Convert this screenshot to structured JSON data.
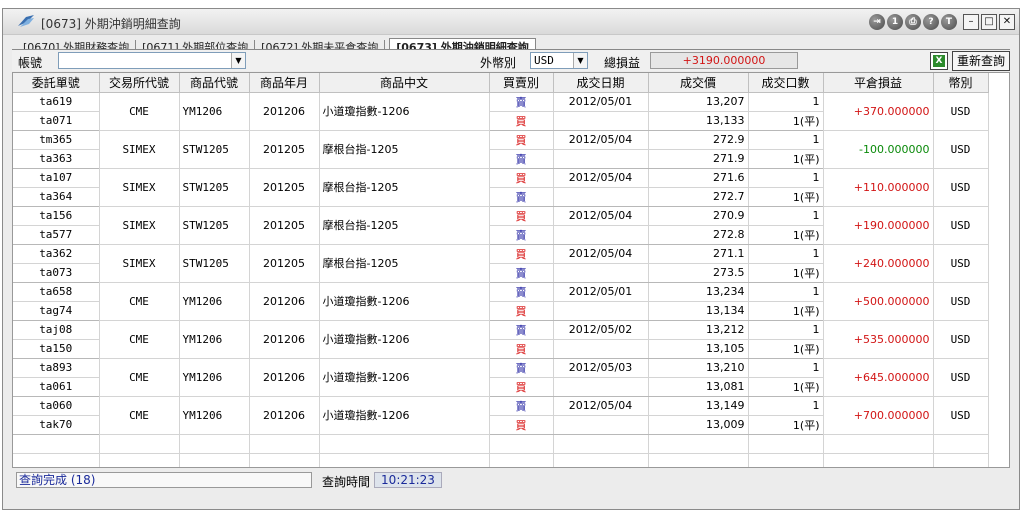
{
  "window": {
    "title": "[0673] 外期沖銷明細查詢",
    "toolbar_icons": [
      "switch-icon",
      "info-1-icon",
      "print-icon",
      "help-icon",
      "t-icon"
    ],
    "toolbar_icon_glyphs": [
      "⇥",
      "1",
      "⎙",
      "?",
      "T"
    ]
  },
  "tabs": [
    {
      "label": "[0670] 外期財務查詢",
      "active": false
    },
    {
      "label": "[0671] 外期部位查詢",
      "active": false
    },
    {
      "label": "[0672] 外期未平倉查詢",
      "active": false
    },
    {
      "label": "[0673] 外期沖銷明細查詢",
      "active": true
    }
  ],
  "toolbar": {
    "account_label": "帳號",
    "account_value": "",
    "currency_label": "外幣別",
    "currency_value": "USD",
    "total_pnl_label": "總損益",
    "total_pnl_value": "+3190.000000",
    "export_icon": "excel-icon",
    "refresh_label": "重新查詢"
  },
  "table": {
    "columns": [
      "委託單號",
      "交易所代號",
      "商品代號",
      "商品年月",
      "商品中文",
      "買賣別",
      "成交日期",
      "成交價",
      "成交口數",
      "平倉損益",
      "幣別"
    ],
    "groups": [
      {
        "exchange": "CME",
        "symbol": "YM1206",
        "ym": "201206",
        "name": "小道瓊指數-1206",
        "pnl": "+370.000000",
        "pnl_sign": "pos",
        "currency": "USD",
        "rows": [
          {
            "order": "ta619",
            "side": "賣",
            "side_type": "sell",
            "date": "2012/05/01",
            "price": "13,207",
            "qty": "1"
          },
          {
            "order": "ta071",
            "side": "買",
            "side_type": "buy",
            "date": "",
            "price": "13,133",
            "qty": "1(平)"
          }
        ]
      },
      {
        "exchange": "SIMEX",
        "symbol": "STW1205",
        "ym": "201205",
        "name": "摩根台指-1205",
        "pnl": "-100.000000",
        "pnl_sign": "neg",
        "currency": "USD",
        "rows": [
          {
            "order": "tm365",
            "side": "買",
            "side_type": "buy",
            "date": "2012/05/04",
            "price": "272.9",
            "qty": "1"
          },
          {
            "order": "ta363",
            "side": "賣",
            "side_type": "sell",
            "date": "",
            "price": "271.9",
            "qty": "1(平)"
          }
        ]
      },
      {
        "exchange": "SIMEX",
        "symbol": "STW1205",
        "ym": "201205",
        "name": "摩根台指-1205",
        "pnl": "+110.000000",
        "pnl_sign": "pos",
        "currency": "USD",
        "rows": [
          {
            "order": "ta107",
            "side": "買",
            "side_type": "buy",
            "date": "2012/05/04",
            "price": "271.6",
            "qty": "1"
          },
          {
            "order": "ta364",
            "side": "賣",
            "side_type": "sell",
            "date": "",
            "price": "272.7",
            "qty": "1(平)"
          }
        ]
      },
      {
        "exchange": "SIMEX",
        "symbol": "STW1205",
        "ym": "201205",
        "name": "摩根台指-1205",
        "pnl": "+190.000000",
        "pnl_sign": "pos",
        "currency": "USD",
        "rows": [
          {
            "order": "ta156",
            "side": "買",
            "side_type": "buy",
            "date": "2012/05/04",
            "price": "270.9",
            "qty": "1"
          },
          {
            "order": "ta577",
            "side": "賣",
            "side_type": "sell",
            "date": "",
            "price": "272.8",
            "qty": "1(平)"
          }
        ]
      },
      {
        "exchange": "SIMEX",
        "symbol": "STW1205",
        "ym": "201205",
        "name": "摩根台指-1205",
        "pnl": "+240.000000",
        "pnl_sign": "pos",
        "currency": "USD",
        "rows": [
          {
            "order": "ta362",
            "side": "買",
            "side_type": "buy",
            "date": "2012/05/04",
            "price": "271.1",
            "qty": "1"
          },
          {
            "order": "ta073",
            "side": "賣",
            "side_type": "sell",
            "date": "",
            "price": "273.5",
            "qty": "1(平)"
          }
        ]
      },
      {
        "exchange": "CME",
        "symbol": "YM1206",
        "ym": "201206",
        "name": "小道瓊指數-1206",
        "pnl": "+500.000000",
        "pnl_sign": "pos",
        "currency": "USD",
        "rows": [
          {
            "order": "ta658",
            "side": "賣",
            "side_type": "sell",
            "date": "2012/05/01",
            "price": "13,234",
            "qty": "1"
          },
          {
            "order": "tag74",
            "side": "買",
            "side_type": "buy",
            "date": "",
            "price": "13,134",
            "qty": "1(平)"
          }
        ]
      },
      {
        "exchange": "CME",
        "symbol": "YM1206",
        "ym": "201206",
        "name": "小道瓊指數-1206",
        "pnl": "+535.000000",
        "pnl_sign": "pos",
        "currency": "USD",
        "rows": [
          {
            "order": "taj08",
            "side": "賣",
            "side_type": "sell",
            "date": "2012/05/02",
            "price": "13,212",
            "qty": "1"
          },
          {
            "order": "ta150",
            "side": "買",
            "side_type": "buy",
            "date": "",
            "price": "13,105",
            "qty": "1(平)"
          }
        ]
      },
      {
        "exchange": "CME",
        "symbol": "YM1206",
        "ym": "201206",
        "name": "小道瓊指數-1206",
        "pnl": "+645.000000",
        "pnl_sign": "pos",
        "currency": "USD",
        "rows": [
          {
            "order": "ta893",
            "side": "賣",
            "side_type": "sell",
            "date": "2012/05/03",
            "price": "13,210",
            "qty": "1"
          },
          {
            "order": "ta061",
            "side": "買",
            "side_type": "buy",
            "date": "",
            "price": "13,081",
            "qty": "1(平)"
          }
        ]
      },
      {
        "exchange": "CME",
        "symbol": "YM1206",
        "ym": "201206",
        "name": "小道瓊指數-1206",
        "pnl": "+700.000000",
        "pnl_sign": "pos",
        "currency": "USD",
        "rows": [
          {
            "order": "ta060",
            "side": "賣",
            "side_type": "sell",
            "date": "2012/05/04",
            "price": "13,149",
            "qty": "1"
          },
          {
            "order": "tak70",
            "side": "買",
            "side_type": "buy",
            "date": "",
            "price": "13,009",
            "qty": "1(平)"
          }
        ]
      }
    ]
  },
  "status": {
    "message": "查詢完成 (18)",
    "time_label": "查詢時間",
    "time_value": "10:21:23"
  },
  "colors": {
    "buy": "#d40000",
    "sell": "#1a1a9e",
    "profit": "#d21414",
    "loss": "#0a8a0a"
  }
}
